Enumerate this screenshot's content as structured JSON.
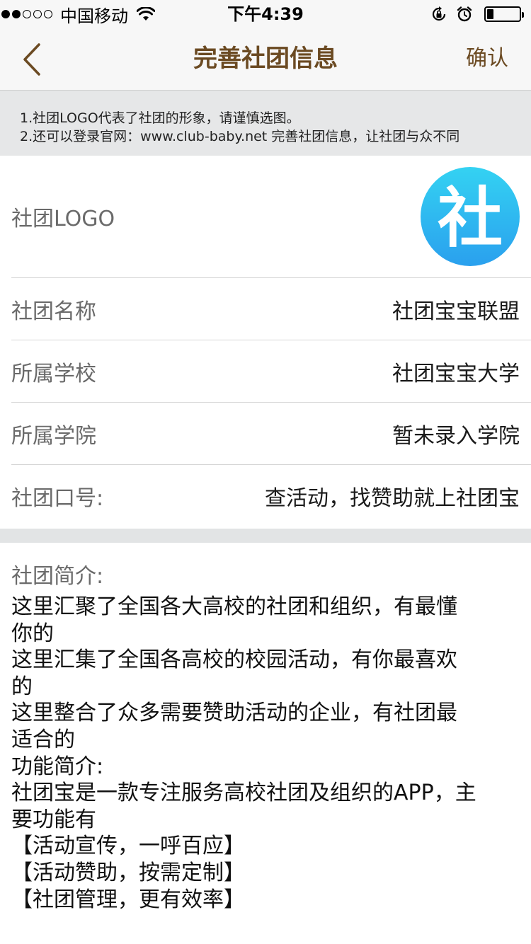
{
  "status_bar": {
    "carrier": "中国移动",
    "time": "下午4:39",
    "signal_strength": 2,
    "battery_level": 0.2
  },
  "nav": {
    "title": "完善社团信息",
    "confirm_label": "确认",
    "text_color": "#6b4a22"
  },
  "tips": {
    "line1": "1.社团LOGO代表了社团的形象，请谨慎选图。",
    "line2": "2.还可以登录官网：www.club-baby.net 完善社团信息，让社团与众不同"
  },
  "form": {
    "logo_label": "社团LOGO",
    "logo_glyph": "社",
    "name_label": "社团名称",
    "name_value": "社团宝宝联盟",
    "school_label": "所属学校",
    "school_value": "社团宝宝大学",
    "college_label": "所属学院",
    "college_value": "暂未录入学院",
    "slogan_label": "社团口号:",
    "slogan_value": "查活动，找赞助就上社团宝"
  },
  "intro": {
    "label": "社团简介:",
    "text": "这里汇聚了全国各大高校的社团和组织，有最懂\n你的\n这里汇集了全国各高校的校园活动，有你最喜欢\n的\n这里整合了众多需要赞助活动的企业，有社团最\n适合的\n功能简介:\n社团宝是一款专注服务高校社团及组织的APP，主\n要功能有\n【活动宣传，一呼百应】\n【活动赞助，按需定制】\n【社团管理，更有效率】"
  }
}
